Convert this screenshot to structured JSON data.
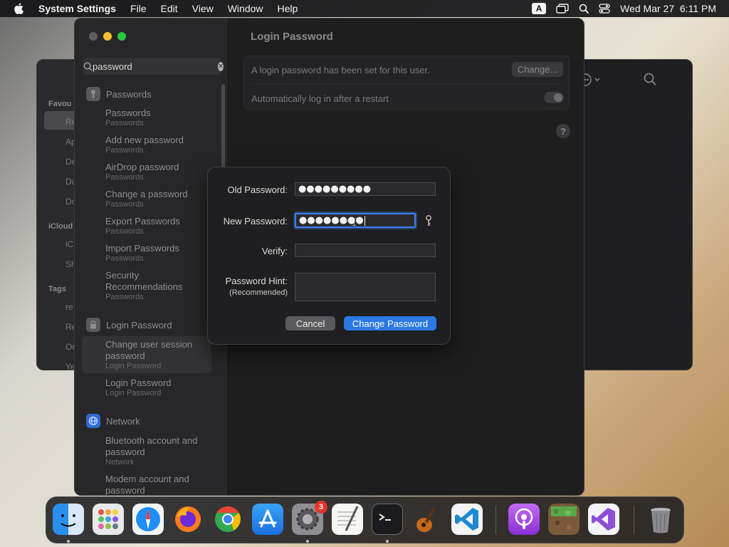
{
  "menubar": {
    "app_name": "System Settings",
    "items": [
      "File",
      "Edit",
      "View",
      "Window",
      "Help"
    ],
    "input_source": "A",
    "datetime": "Wed Mar 27  6:11 PM"
  },
  "background_window": {
    "sidebar_labels": [
      "Favou",
      "iCloud",
      "Tags"
    ],
    "sidebar_items": [
      "Re",
      "Ap",
      "De",
      "Du",
      "Do",
      "iC",
      "Sh",
      "re",
      "Re",
      "Or",
      "Ye"
    ]
  },
  "search": {
    "value": "password",
    "placeholder": "Search"
  },
  "sidebar": {
    "groups": [
      {
        "title": "Passwords",
        "results": [
          {
            "title": "Passwords",
            "sub": "Passwords"
          },
          {
            "title": "Add new password",
            "sub": "Passwords"
          },
          {
            "title": "AirDrop password",
            "sub": "Passwords"
          },
          {
            "title": "Change a password",
            "sub": "Passwords"
          },
          {
            "title": "Export Passwords",
            "sub": "Passwords"
          },
          {
            "title": "Import Passwords",
            "sub": "Passwords"
          },
          {
            "title": "Security Recommendations",
            "sub": "Passwords"
          }
        ]
      },
      {
        "title": "Login Password",
        "results": [
          {
            "title": "Change user session password",
            "sub": "Login Password"
          },
          {
            "title": "Login Password",
            "sub": "Login Password"
          }
        ]
      },
      {
        "title": "Network",
        "results": [
          {
            "title": "Bluetooth account and password",
            "sub": "Network"
          },
          {
            "title": "Modem account and password",
            "sub": ""
          }
        ]
      }
    ]
  },
  "content": {
    "title": "Login Password",
    "status_text": "A login password has been set for this user.",
    "change_label": "Change...",
    "autologin_label": "Automatically log in after a restart",
    "help": "?"
  },
  "dialog": {
    "old_label": "Old Password:",
    "old_value": "●●●●●●●●●",
    "new_label": "New Password:",
    "new_value": "●●●●●●●●",
    "verify_label": "Verify:",
    "verify_value": "",
    "hint_label": "Password Hint:",
    "hint_sub": "(Recommended)",
    "hint_value": "",
    "cancel_label": "Cancel",
    "submit_label": "Change Password"
  },
  "dock": {
    "settings_badge": "3",
    "apps": [
      "finder",
      "launchpad",
      "safari",
      "firefox",
      "chrome",
      "app-store",
      "system-settings",
      "textedit",
      "terminal",
      "garageband",
      "vscode",
      "podcasts",
      "minecraft",
      "visual-studio",
      "trash"
    ]
  }
}
